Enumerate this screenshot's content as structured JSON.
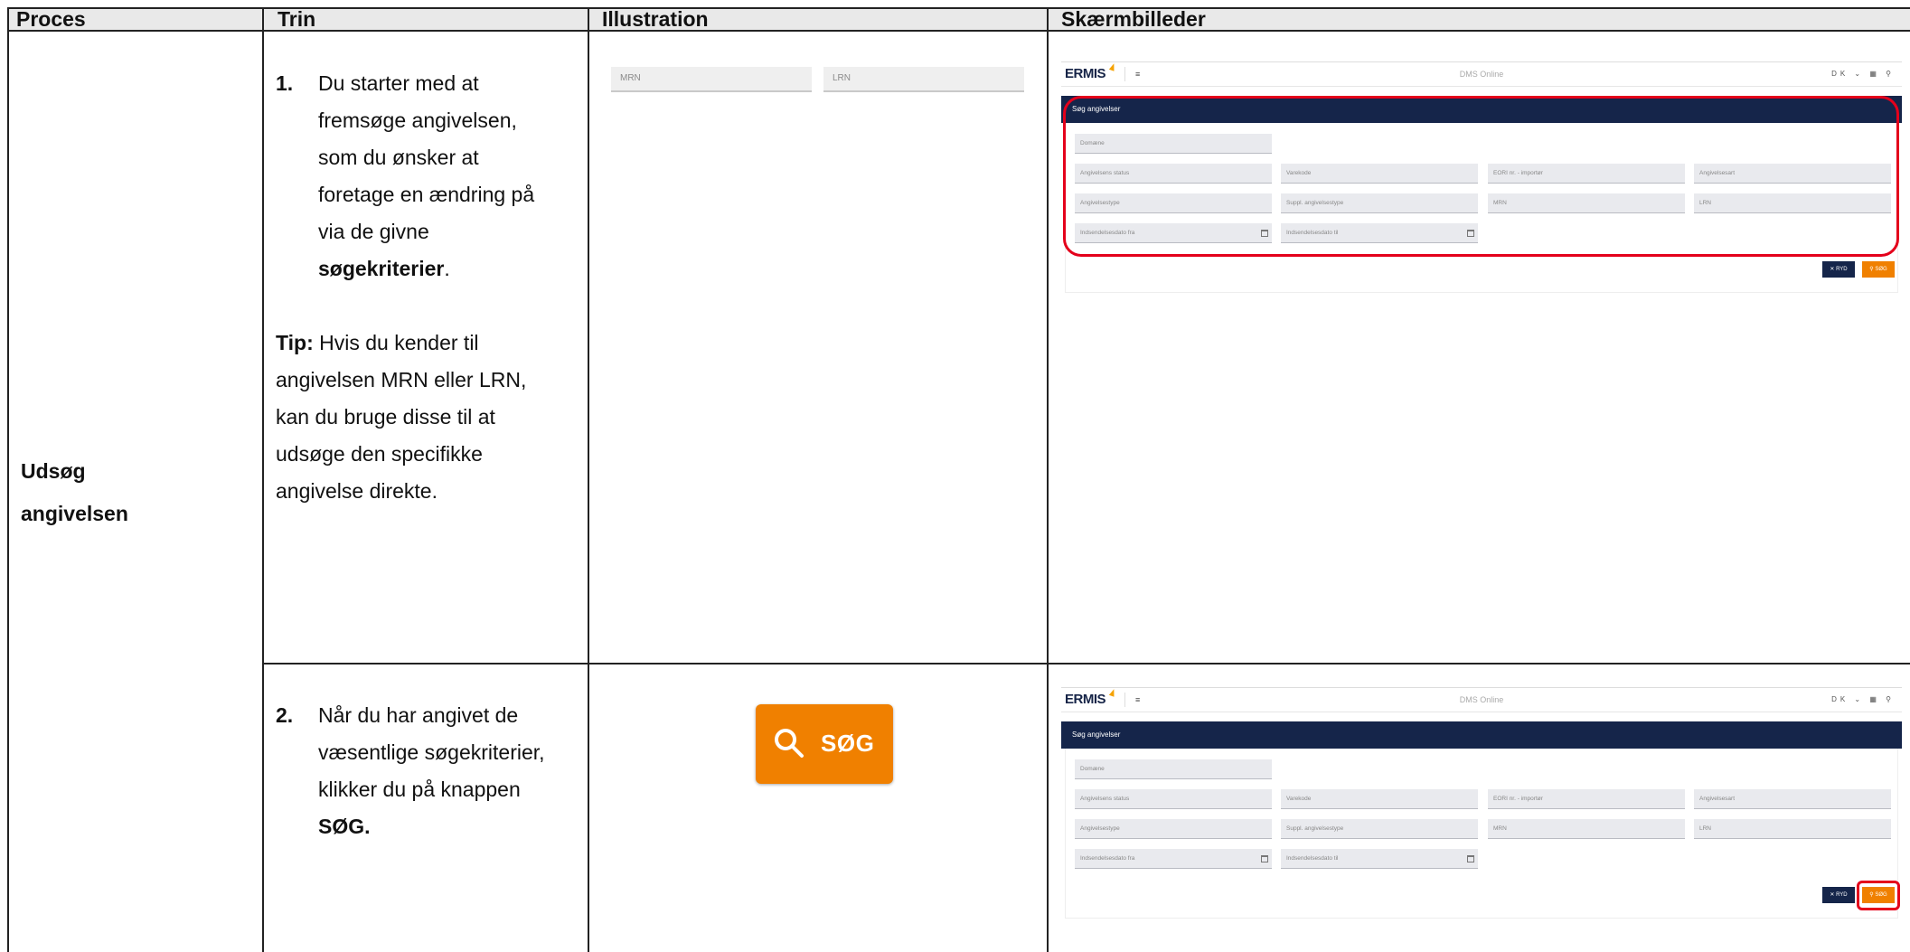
{
  "header": {
    "col_proces": "Proces",
    "col_trin": "Trin",
    "col_illustration": "Illustration",
    "col_screenshots": "Skærmbilleder"
  },
  "process": {
    "label_line1": "Udsøg",
    "label_line2": "angivelsen"
  },
  "step1": {
    "number": "1.",
    "line1": "Du starter med at",
    "line2": "fremsøge angivelsen,",
    "line3": "som du ønsker at",
    "line4": "foretage en ændring på",
    "line5": "via de givne",
    "bold_word": "søgekriterier",
    "period": ".",
    "tip_label": "Tip:",
    "tip_line1": " Hvis du kender til",
    "tip_line2": "angivelsen MRN eller LRN,",
    "tip_line3": "kan du bruge disse til at",
    "tip_line4": "udsøge den specifikke",
    "tip_line5": "angivelse direkte."
  },
  "step2": {
    "number": "2.",
    "line1": "Når du har angivet de",
    "line2": "væsentlige søgekriterier,",
    "line3": "klikker du på knappen",
    "bold_word": "SØG."
  },
  "illustration1": {
    "field_mrn": "MRN",
    "field_lrn": "LRN"
  },
  "illustration2": {
    "button_label": "SØG",
    "button_color": "#f08000",
    "icon": "search-icon"
  },
  "screenshot": {
    "logo": "ERMIS",
    "app_title": "DMS Online",
    "menu_icon": "≡",
    "lang": "DK",
    "panel_title": "Søg angivelser",
    "fields": {
      "domain": "Domæne",
      "status": "Angivelsens status",
      "commodity": "Varekode",
      "eori": "EORI nr. - importør",
      "kind": "Angivelsesart",
      "type": "Angivelsestype",
      "supp_type": "Suppl. angivelsestype",
      "mrn": "MRN",
      "lrn": "LRN",
      "date_from": "Indsendelsesdato fra",
      "date_to": "Indsendelsesdato til"
    },
    "btn_clear": "RYD",
    "btn_search": "SØG",
    "accent_color": "#f08000",
    "band_color": "#15254a",
    "highlight_color": "#e4001b"
  }
}
